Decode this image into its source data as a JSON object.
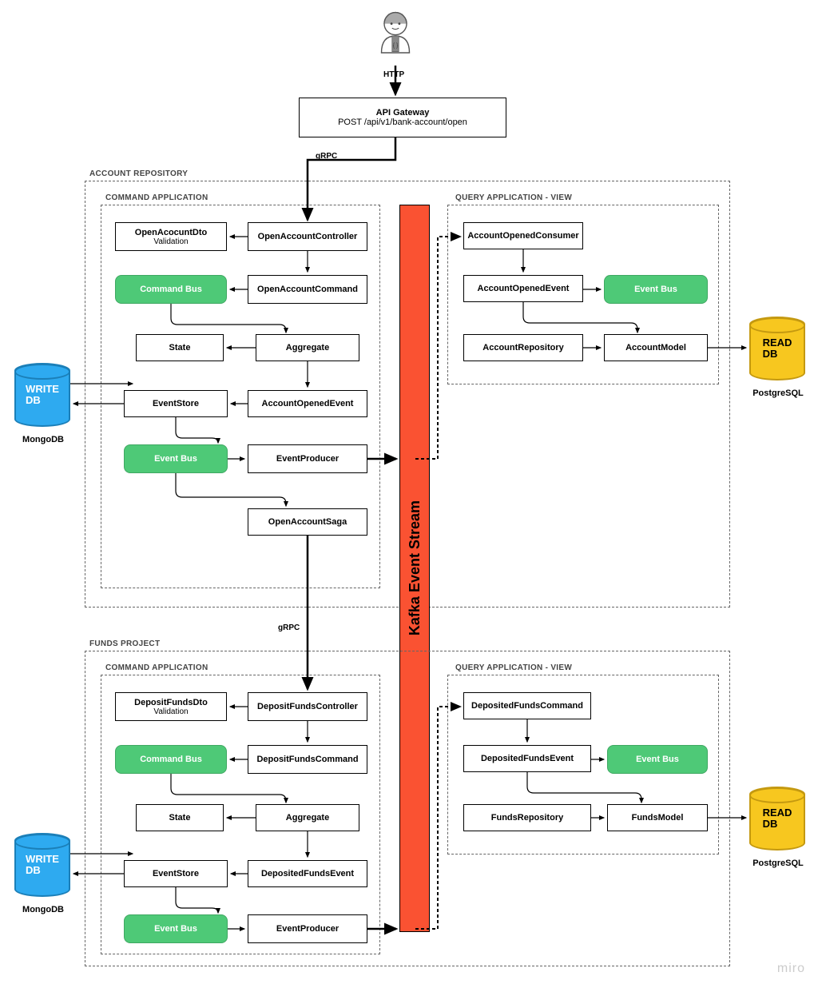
{
  "user_label": "HTTP",
  "gateway": {
    "title": "API Gateway",
    "subtitle": "POST /api/v1/bank-account/open"
  },
  "grpc1": "gRPC",
  "grpc2": "gRPC",
  "account_repo_label": "ACCOUNT REPOSITORY",
  "funds_project_label": "FUNDS PROJECT",
  "command_app_label": "COMMAND APPLICATION",
  "query_app_label": "QUERY APPLICATION - VIEW",
  "kafka": "Kafka Event Stream",
  "cmd1": {
    "OpenAccountDto": "OpenAcocuntDto",
    "validation": "Validation",
    "OpenAccountController": "OpenAccountController",
    "CommandBus": "Command Bus",
    "OpenAccountCommand": "OpenAccountCommand",
    "State": "State",
    "Aggregate": "Aggregate",
    "EventStore": "EventStore",
    "AccountOpenedEvent": "AccountOpenedEvent",
    "EventBus": "Event Bus",
    "EventProducer": "EventProducer",
    "OpenAccountSaga": "OpenAccountSaga"
  },
  "qry1": {
    "AccountOpenedConsumer": "AccountOpenedConsumer",
    "AccountOpenedEvent": "AccountOpenedEvent",
    "EventBus": "Event Bus",
    "AccountRepository": "AccountRepository",
    "AccountModel": "AccountModel"
  },
  "cmd2": {
    "DepositFundsDto": "DepositFundsDto",
    "validation": "Validation",
    "DepositFundsController": "DepositFundsController",
    "CommandBus": "Command Bus",
    "DepositFundsCommand": "DepositFundsCommand",
    "State": "State",
    "Aggregate": "Aggregate",
    "EventStore": "EventStore",
    "DepositedFundsEvent": "DepositedFundsEvent",
    "EventBus": "Event Bus",
    "EventProducer": "EventProducer"
  },
  "qry2": {
    "DepositedFundsCommand": "DepositedFundsCommand",
    "DepositedFundsEvent": "DepositedFundsEvent",
    "EventBus": "Event Bus",
    "FundsRepository": "FundsRepository",
    "FundsModel": "FundsModel"
  },
  "write_db": "WRITE\nDB",
  "read_db": "READ\nDB",
  "mongodb": "MongoDB",
  "postgresql": "PostgreSQL",
  "watermark": "miro"
}
